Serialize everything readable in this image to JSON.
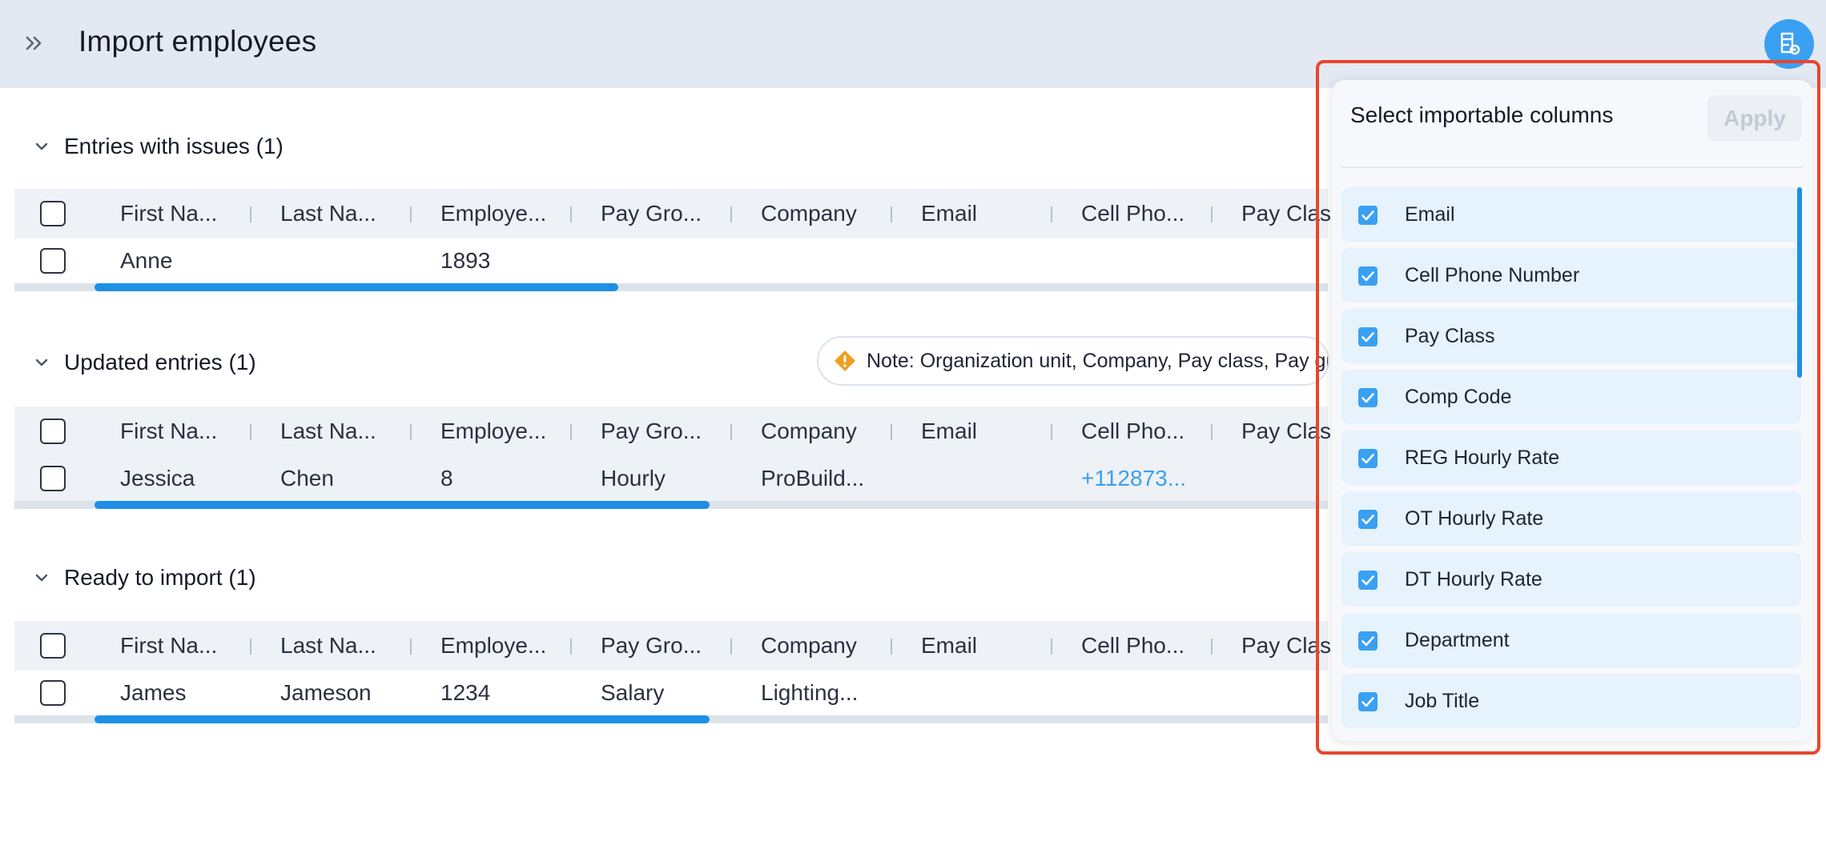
{
  "header": {
    "title": "Import employees"
  },
  "columns": [
    "First Na...",
    "Last Na...",
    "Employe...",
    "Pay Gro...",
    "Company",
    "Email",
    "Cell Pho...",
    "Pay Clas"
  ],
  "sections": [
    {
      "title": "Entries with issues (1)",
      "row": {
        "first": "Anne",
        "last": "",
        "emp": "1893",
        "pay_group": "",
        "company": "",
        "email": "",
        "cell": ""
      }
    },
    {
      "title": "Updated entries (1)",
      "row": {
        "first": "Jessica",
        "last": "Chen",
        "emp": "8",
        "pay_group": "Hourly",
        "company": "ProBuild...",
        "email": "",
        "cell": "+112873..."
      }
    },
    {
      "title": "Ready to import (1)",
      "row": {
        "first": "James",
        "last": "Jameson",
        "emp": "1234",
        "pay_group": "Salary",
        "company": "Lighting...",
        "email": "",
        "cell": ""
      }
    }
  ],
  "note": {
    "text": "Note: Organization unit, Company, Pay class, Pay gr"
  },
  "popover": {
    "title": "Select importable columns",
    "apply_label": "Apply",
    "options": [
      "Email",
      "Cell Phone Number",
      "Pay Class",
      "Comp Code",
      "REG Hourly Rate",
      "OT Hourly Rate",
      "DT Hourly Rate",
      "Department",
      "Job Title"
    ]
  },
  "colors": {
    "accent": "#3aa0f2",
    "highlight_border": "#e8462b",
    "warning": "#f0a020"
  },
  "icons": {
    "collapse": "double-chevron-right-icon",
    "settings": "column-settings-icon",
    "section": "chevron-down-icon",
    "warning": "warning-diamond-icon",
    "checkbox": "checkbox-icon"
  }
}
